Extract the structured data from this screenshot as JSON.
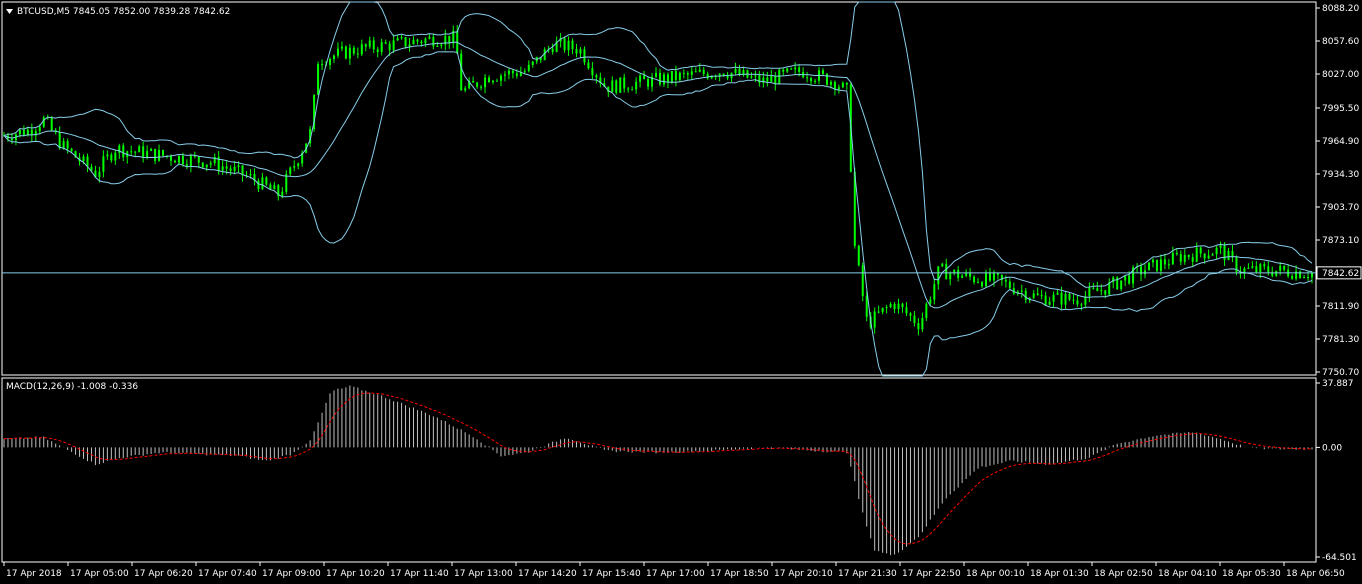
{
  "header": {
    "symbol_line": "BTCUSD,M5  7845.05 7852.00 7839.28 7842.62",
    "macd_line": "MACD(12,26,9) -1.008 -0.336"
  },
  "colors": {
    "background": "#000000",
    "frame": "#ffffff",
    "candles": "#00ff00",
    "bollinger": "#87ceeb",
    "price_line": "#87ceeb",
    "macd_histogram": "#c0c0c0",
    "macd_signal": "#ff0000",
    "current_price_label_bg": "#000000"
  },
  "chart_data": [
    {
      "type": "candlestick",
      "symbol": "BTCUSD",
      "timeframe": "M5",
      "ylim": [
        7750.7,
        8088.2
      ],
      "price_ticks": [
        "8088.20",
        "8057.60",
        "8027.00",
        "7995.50",
        "7964.90",
        "7934.30",
        "7903.70",
        "7873.10",
        "7842.62",
        "7811.90",
        "7781.30",
        "7750.70"
      ],
      "current_price": "7842.62",
      "x_ticks": [
        "17 Apr 2018",
        "17 Apr 05:00",
        "17 Apr 06:20",
        "17 Apr 07:40",
        "17 Apr 09:00",
        "17 Apr 10:20",
        "17 Apr 11:40",
        "17 Apr 13:00",
        "17 Apr 14:20",
        "17 Apr 15:40",
        "17 Apr 17:00",
        "17 Apr 18:50",
        "17 Apr 20:10",
        "17 Apr 21:30",
        "17 Apr 22:50",
        "18 Apr 00:10",
        "18 Apr 01:30",
        "18 Apr 02:50",
        "18 Apr 04:10",
        "18 Apr 05:30",
        "18 Apr 06:50"
      ],
      "close_profile": [
        {
          "t": 0,
          "v": 7970
        },
        {
          "t": 0.02,
          "v": 7975
        },
        {
          "t": 0.03,
          "v": 7985
        },
        {
          "t": 0.045,
          "v": 7960
        },
        {
          "t": 0.07,
          "v": 7935
        },
        {
          "t": 0.085,
          "v": 7958
        },
        {
          "t": 0.1,
          "v": 7955
        },
        {
          "t": 0.13,
          "v": 7950
        },
        {
          "t": 0.16,
          "v": 7945
        },
        {
          "t": 0.19,
          "v": 7930
        },
        {
          "t": 0.21,
          "v": 7915
        },
        {
          "t": 0.225,
          "v": 7950
        },
        {
          "t": 0.235,
          "v": 7975
        },
        {
          "t": 0.24,
          "v": 8040
        },
        {
          "t": 0.27,
          "v": 8050
        },
        {
          "t": 0.3,
          "v": 8055
        },
        {
          "t": 0.33,
          "v": 8060
        },
        {
          "t": 0.345,
          "v": 8060
        },
        {
          "t": 0.35,
          "v": 8010
        },
        {
          "t": 0.37,
          "v": 8025
        },
        {
          "t": 0.4,
          "v": 8030
        },
        {
          "t": 0.42,
          "v": 8055
        },
        {
          "t": 0.44,
          "v": 8050
        },
        {
          "t": 0.46,
          "v": 8015
        },
        {
          "t": 0.49,
          "v": 8020
        },
        {
          "t": 0.52,
          "v": 8025
        },
        {
          "t": 0.55,
          "v": 8030
        },
        {
          "t": 0.58,
          "v": 8020
        },
        {
          "t": 0.61,
          "v": 8030
        },
        {
          "t": 0.635,
          "v": 8020
        },
        {
          "t": 0.645,
          "v": 8010
        },
        {
          "t": 0.65,
          "v": 7870
        },
        {
          "t": 0.66,
          "v": 7795
        },
        {
          "t": 0.68,
          "v": 7815
        },
        {
          "t": 0.7,
          "v": 7795
        },
        {
          "t": 0.715,
          "v": 7845
        },
        {
          "t": 0.74,
          "v": 7838
        },
        {
          "t": 0.76,
          "v": 7835
        },
        {
          "t": 0.79,
          "v": 7820
        },
        {
          "t": 0.82,
          "v": 7818
        },
        {
          "t": 0.845,
          "v": 7830
        },
        {
          "t": 0.87,
          "v": 7845
        },
        {
          "t": 0.9,
          "v": 7858
        },
        {
          "t": 0.93,
          "v": 7864
        },
        {
          "t": 0.945,
          "v": 7845
        },
        {
          "t": 0.97,
          "v": 7845
        },
        {
          "t": 1,
          "v": 7842.62
        }
      ]
    },
    {
      "type": "histogram",
      "indicator": "MACD(12,26,9)",
      "macd": -1.008,
      "signal": -0.336,
      "ylim": [
        -64.501,
        37.887
      ],
      "ticks": [
        "37.887",
        "0.00",
        "-64.501"
      ],
      "profile": [
        {
          "t": 0,
          "v": 5
        },
        {
          "t": 0.03,
          "v": 6
        },
        {
          "t": 0.05,
          "v": -2
        },
        {
          "t": 0.07,
          "v": -10
        },
        {
          "t": 0.09,
          "v": -6
        },
        {
          "t": 0.12,
          "v": -3
        },
        {
          "t": 0.15,
          "v": -4
        },
        {
          "t": 0.18,
          "v": -5
        },
        {
          "t": 0.2,
          "v": -8
        },
        {
          "t": 0.22,
          "v": -4
        },
        {
          "t": 0.235,
          "v": 5
        },
        {
          "t": 0.25,
          "v": 33
        },
        {
          "t": 0.265,
          "v": 36
        },
        {
          "t": 0.29,
          "v": 30
        },
        {
          "t": 0.33,
          "v": 18
        },
        {
          "t": 0.36,
          "v": 6
        },
        {
          "t": 0.38,
          "v": -5
        },
        {
          "t": 0.4,
          "v": -3
        },
        {
          "t": 0.43,
          "v": 6
        },
        {
          "t": 0.46,
          "v": -2
        },
        {
          "t": 0.5,
          "v": -3
        },
        {
          "t": 0.54,
          "v": -2
        },
        {
          "t": 0.58,
          "v": 0
        },
        {
          "t": 0.62,
          "v": -2
        },
        {
          "t": 0.645,
          "v": -3
        },
        {
          "t": 0.655,
          "v": -35
        },
        {
          "t": 0.665,
          "v": -60
        },
        {
          "t": 0.68,
          "v": -64
        },
        {
          "t": 0.7,
          "v": -52
        },
        {
          "t": 0.72,
          "v": -30
        },
        {
          "t": 0.745,
          "v": -12
        },
        {
          "t": 0.77,
          "v": -8
        },
        {
          "t": 0.8,
          "v": -10
        },
        {
          "t": 0.83,
          "v": -6
        },
        {
          "t": 0.85,
          "v": 2
        },
        {
          "t": 0.88,
          "v": 7
        },
        {
          "t": 0.91,
          "v": 9
        },
        {
          "t": 0.93,
          "v": 5
        },
        {
          "t": 0.95,
          "v": 0
        },
        {
          "t": 0.97,
          "v": -1
        },
        {
          "t": 1,
          "v": -1.008
        }
      ]
    }
  ]
}
